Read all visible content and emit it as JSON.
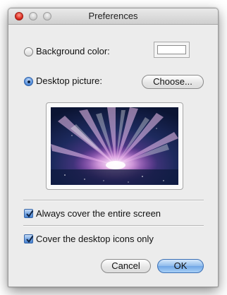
{
  "window": {
    "title": "Preferences"
  },
  "options": {
    "background_color_label": "Background color:",
    "desktop_picture_label": "Desktop picture:",
    "choose_label": "Choose...",
    "background_selected": false,
    "desktop_picture_selected": true
  },
  "checkboxes": {
    "cover_screen_label": "Always cover the entire screen",
    "cover_screen_checked": true,
    "cover_icons_label": "Cover the desktop icons only",
    "cover_icons_checked": true
  },
  "buttons": {
    "cancel_label": "Cancel",
    "ok_label": "OK"
  },
  "colors": {
    "accent": "#5b93de",
    "window_bg": "#ececec",
    "well_color": "#ffffff"
  }
}
